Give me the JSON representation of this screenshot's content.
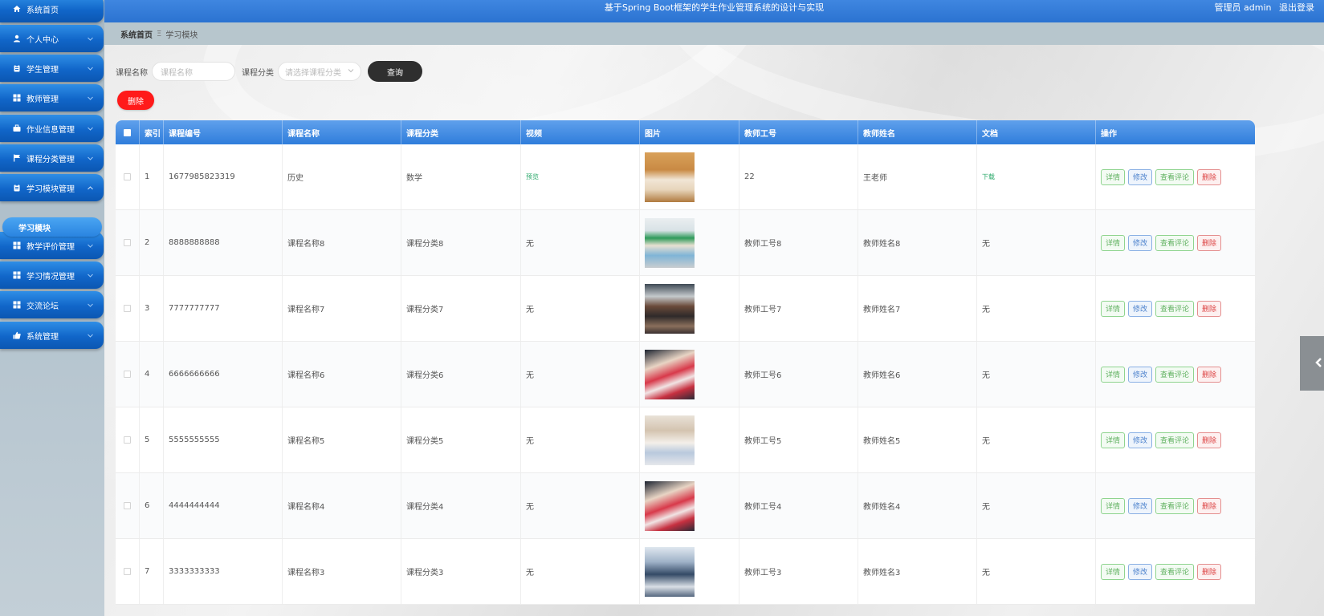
{
  "sidebar": {
    "items": [
      {
        "label": "系统首页",
        "icon": "home-icon",
        "expandable": false
      },
      {
        "label": "个人中心",
        "icon": "user-icon",
        "expandable": true
      },
      {
        "label": "学生管理",
        "icon": "clipboard-icon",
        "expandable": true
      },
      {
        "label": "教师管理",
        "icon": "grid-icon",
        "expandable": true
      },
      {
        "label": "作业信息管理",
        "icon": "briefcase-icon",
        "expandable": true
      },
      {
        "label": "课程分类管理",
        "icon": "flag-icon",
        "expandable": true
      },
      {
        "label": "学习模块管理",
        "icon": "clipboard-icon",
        "expandable": true,
        "expanded": true
      },
      {
        "label": "教学评价管理",
        "icon": "grid-icon",
        "expandable": true
      },
      {
        "label": "学习情况管理",
        "icon": "grid-icon",
        "expandable": true
      },
      {
        "label": "交流论坛",
        "icon": "grid-icon",
        "expandable": true
      },
      {
        "label": "系统管理",
        "icon": "thumbs-up-icon",
        "expandable": true
      }
    ],
    "submenu_active": "学习模块"
  },
  "header": {
    "title": "基于Spring Boot框架的学生作业管理系统的设计与实现",
    "user_label": "管理员 admin",
    "logout_label": "退出登录"
  },
  "breadcrumb": {
    "home": "系统首页",
    "separator": "Ξ",
    "current": "学习模块"
  },
  "search": {
    "course_name_label": "课程名称",
    "course_name_placeholder": "课程名称",
    "category_label": "课程分类",
    "category_placeholder": "请选择课程分类",
    "search_button": "查询",
    "delete_button": "删除"
  },
  "table": {
    "headers": [
      "索引",
      "课程编号",
      "课程名称",
      "课程分类",
      "视频",
      "图片",
      "教师工号",
      "教师姓名",
      "文档",
      "操作"
    ],
    "ops": {
      "detail": "详情",
      "edit": "修改",
      "comment": "查看评论",
      "delete": "删除"
    },
    "rows": [
      {
        "index": "1",
        "code": "1677985823319",
        "name": "历史",
        "category": "数学",
        "video": "预览",
        "video_link": true,
        "teacher_id": "22",
        "teacher_name": "王老师",
        "doc": "下载",
        "doc_link": true,
        "img": "books"
      },
      {
        "index": "2",
        "code": "8888888888",
        "name": "课程名称8",
        "category": "课程分类8",
        "video": "无",
        "video_link": false,
        "teacher_id": "教师工号8",
        "teacher_name": "教师姓名8",
        "doc": "无",
        "doc_link": false,
        "img": "classroom-green"
      },
      {
        "index": "3",
        "code": "7777777777",
        "name": "课程名称7",
        "category": "课程分类7",
        "video": "无",
        "video_link": false,
        "teacher_id": "教师工号7",
        "teacher_name": "教师姓名7",
        "doc": "无",
        "doc_link": false,
        "img": "classroom-dark"
      },
      {
        "index": "4",
        "code": "6666666666",
        "name": "课程名称6",
        "category": "课程分类6",
        "video": "无",
        "video_link": false,
        "teacher_id": "教师工号6",
        "teacher_name": "教师姓名6",
        "doc": "无",
        "doc_link": false,
        "img": "students-red"
      },
      {
        "index": "5",
        "code": "5555555555",
        "name": "课程名称5",
        "category": "课程分类5",
        "video": "无",
        "video_link": false,
        "teacher_id": "教师工号5",
        "teacher_name": "教师姓名5",
        "doc": "无",
        "doc_link": false,
        "img": "students-writing"
      },
      {
        "index": "6",
        "code": "4444444444",
        "name": "课程名称4",
        "category": "课程分类4",
        "video": "无",
        "video_link": false,
        "teacher_id": "教师工号4",
        "teacher_name": "教师姓名4",
        "doc": "无",
        "doc_link": false,
        "img": "students-red"
      },
      {
        "index": "7",
        "code": "3333333333",
        "name": "课程名称3",
        "category": "课程分类3",
        "video": "无",
        "video_link": false,
        "teacher_id": "教师工号3",
        "teacher_name": "教师姓名3",
        "doc": "无",
        "doc_link": false,
        "img": "classroom-blue"
      }
    ]
  }
}
